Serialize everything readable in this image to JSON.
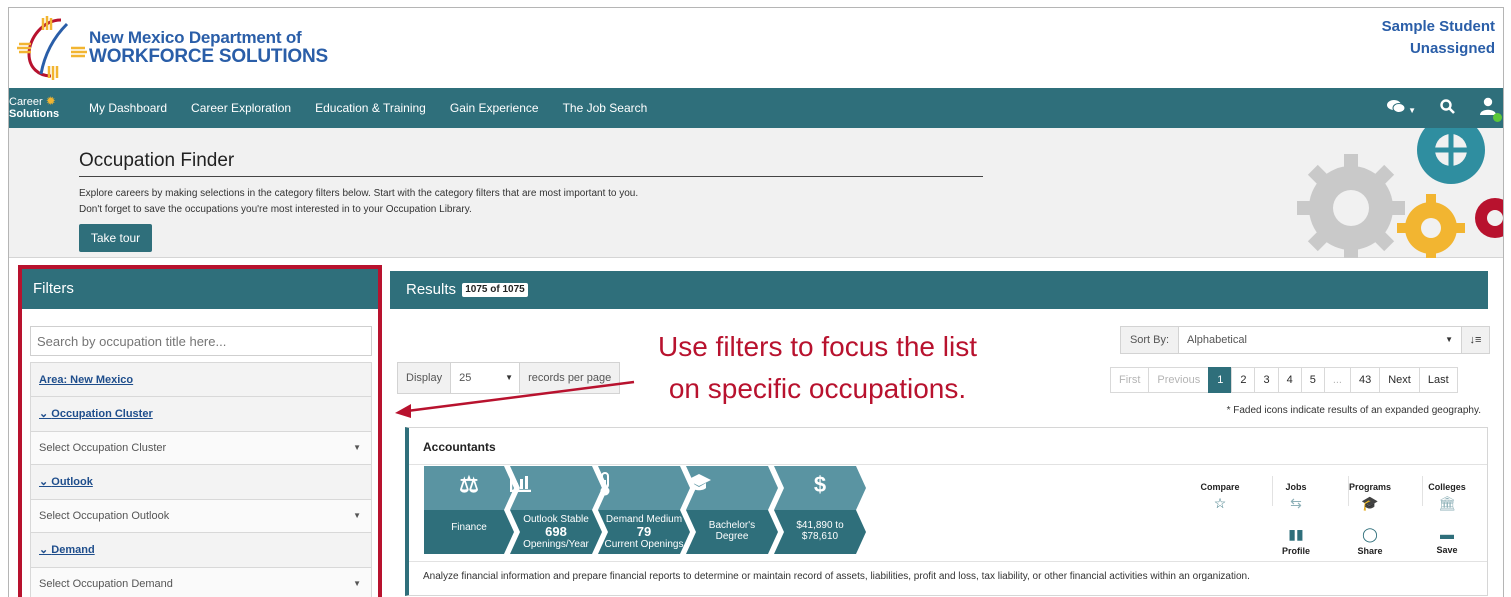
{
  "header": {
    "org_line1": "New Mexico Department of",
    "org_line2": "WORKFORCE SOLUTIONS",
    "user_name": "Sample Student",
    "user_status": "Unassigned"
  },
  "nav": {
    "brand_line1": "Career",
    "brand_line2": "Solutions",
    "items": [
      "My Dashboard",
      "Career Exploration",
      "Education & Training",
      "Gain Experience",
      "The Job Search"
    ],
    "icons": [
      "chat-icon",
      "search-icon",
      "user-icon"
    ]
  },
  "hero": {
    "title": "Occupation Finder",
    "line1": "Explore careers by making selections in the category filters below. Start with the category filters that are most important to you.",
    "line2": "Don't forget to save the occupations you're most interested in to your Occupation Library.",
    "tour_button": "Take tour"
  },
  "filters": {
    "title": "Filters",
    "search_placeholder": "Search by occupation title here...",
    "area_link": "Area: New Mexico",
    "sections": [
      {
        "label": "Occupation Cluster",
        "select": "Select Occupation Cluster"
      },
      {
        "label": "Outlook",
        "select": "Select Occupation Outlook"
      },
      {
        "label": "Demand",
        "select": "Select Occupation Demand"
      }
    ]
  },
  "results": {
    "title": "Results",
    "count": "1075 of 1075",
    "display_label": "Display",
    "display_value": "25",
    "display_suffix": "records per page",
    "sort_label": "Sort By:",
    "sort_value": "Alphabetical",
    "pager": [
      "First",
      "Previous",
      "1",
      "2",
      "3",
      "4",
      "5",
      "...",
      "43",
      "Next",
      "Last"
    ],
    "faded_note": "* Faded icons indicate results of an expanded geography.",
    "annotation_line1": "Use filters to focus the list",
    "annotation_line2": "on specific occupations."
  },
  "occupation": {
    "title": "Accountants",
    "tiles": [
      {
        "icon": "scale-icon",
        "glyph": "⚖",
        "top": "",
        "value": "",
        "bottom": "Finance"
      },
      {
        "icon": "bar-chart-icon",
        "glyph": "▐▌",
        "top": "Outlook Stable",
        "value": "698",
        "bottom": "Openings/Year"
      },
      {
        "icon": "thermometer-icon",
        "glyph": "🌡",
        "top": "Demand Medium",
        "value": "79",
        "bottom": "Current Openings"
      },
      {
        "icon": "graduation-cap-icon",
        "glyph": "🎓",
        "top": "Bachelor's",
        "value": "",
        "bottom": "Degree"
      },
      {
        "icon": "dollar-icon",
        "glyph": "$",
        "top": "$41,890 to",
        "value": "",
        "bottom": "$78,610"
      }
    ],
    "actions_top": [
      {
        "label": "Compare",
        "icon": "star-icon",
        "glyph": "☆"
      },
      {
        "label": "Jobs",
        "icon": "handshake-icon",
        "glyph": "⇆"
      },
      {
        "label": "Programs",
        "icon": "graduation-cap-icon",
        "glyph": "🎓"
      },
      {
        "label": "Colleges",
        "icon": "institution-icon",
        "glyph": "🏛"
      }
    ],
    "actions_bottom": [
      {
        "label": "Profile",
        "icon": "briefcase-icon",
        "glyph": "▮"
      },
      {
        "label": "Share",
        "icon": "comment-icon",
        "glyph": "◯"
      },
      {
        "label": "Save",
        "icon": "folder-icon",
        "glyph": "▬"
      }
    ],
    "description": "Analyze financial information and prepare financial reports to determine or maintain record of assets, liabilities, profit and loss, tax liability, or other financial activities within an organization."
  },
  "colors": {
    "teal": "#2f6f7b",
    "brand_blue": "#2a5ea8",
    "highlight_red": "#b8122e",
    "gear_yellow": "#f2b531"
  }
}
